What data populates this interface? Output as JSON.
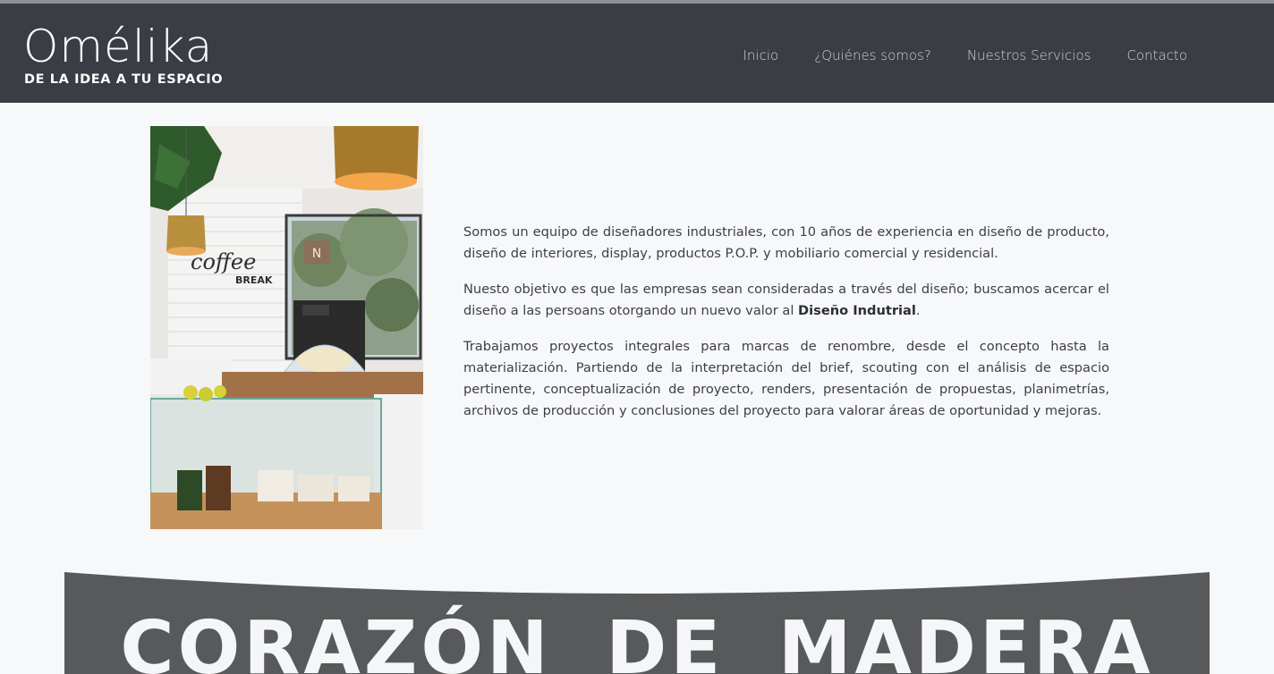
{
  "brand": {
    "name": "Omélika",
    "tagline": "DE LA IDEA A TU ESPACIO"
  },
  "nav": {
    "items": [
      {
        "label": "Inicio"
      },
      {
        "label": "¿Quiénes somos?"
      },
      {
        "label": "Nuestros Servicios"
      },
      {
        "label": "Contacto"
      }
    ]
  },
  "photo": {
    "sign_line1": "coffee",
    "sign_line2": "BREAK",
    "logo_letter": "N"
  },
  "about": {
    "p1": "Somos un equipo de diseñadores industriales, con 10 años de experiencia en diseño de producto, diseño de interiores, display, productos P.O.P. y mobiliario comercial y residencial.",
    "p2_before": "Nuesto objetivo es que las empresas sean consideradas a través del diseño; buscamos acercar el diseño a las persoans otorgando un nuevo valor al ",
    "p2_bold": "Diseño Indutrial",
    "p2_after": ".",
    "p3": "Trabajamos proyectos integrales para marcas de renombre, desde el concepto hasta la materialización. Partiendo de la interpretación del brief, scouting con el análisis de espacio pertinente, conceptualización de proyecto, renders, presentación de propuestas, planimetrías, archivos de producción y conclusiones del proyecto para valorar áreas de oportunidad y mejoras."
  },
  "banner": {
    "title": "CORAZÓN DE MADERA"
  },
  "colors": {
    "header_bg": "#3a3d43",
    "page_bg": "#f7f8fa",
    "banner_bg": "#58595b",
    "text": "#3d3f44"
  }
}
